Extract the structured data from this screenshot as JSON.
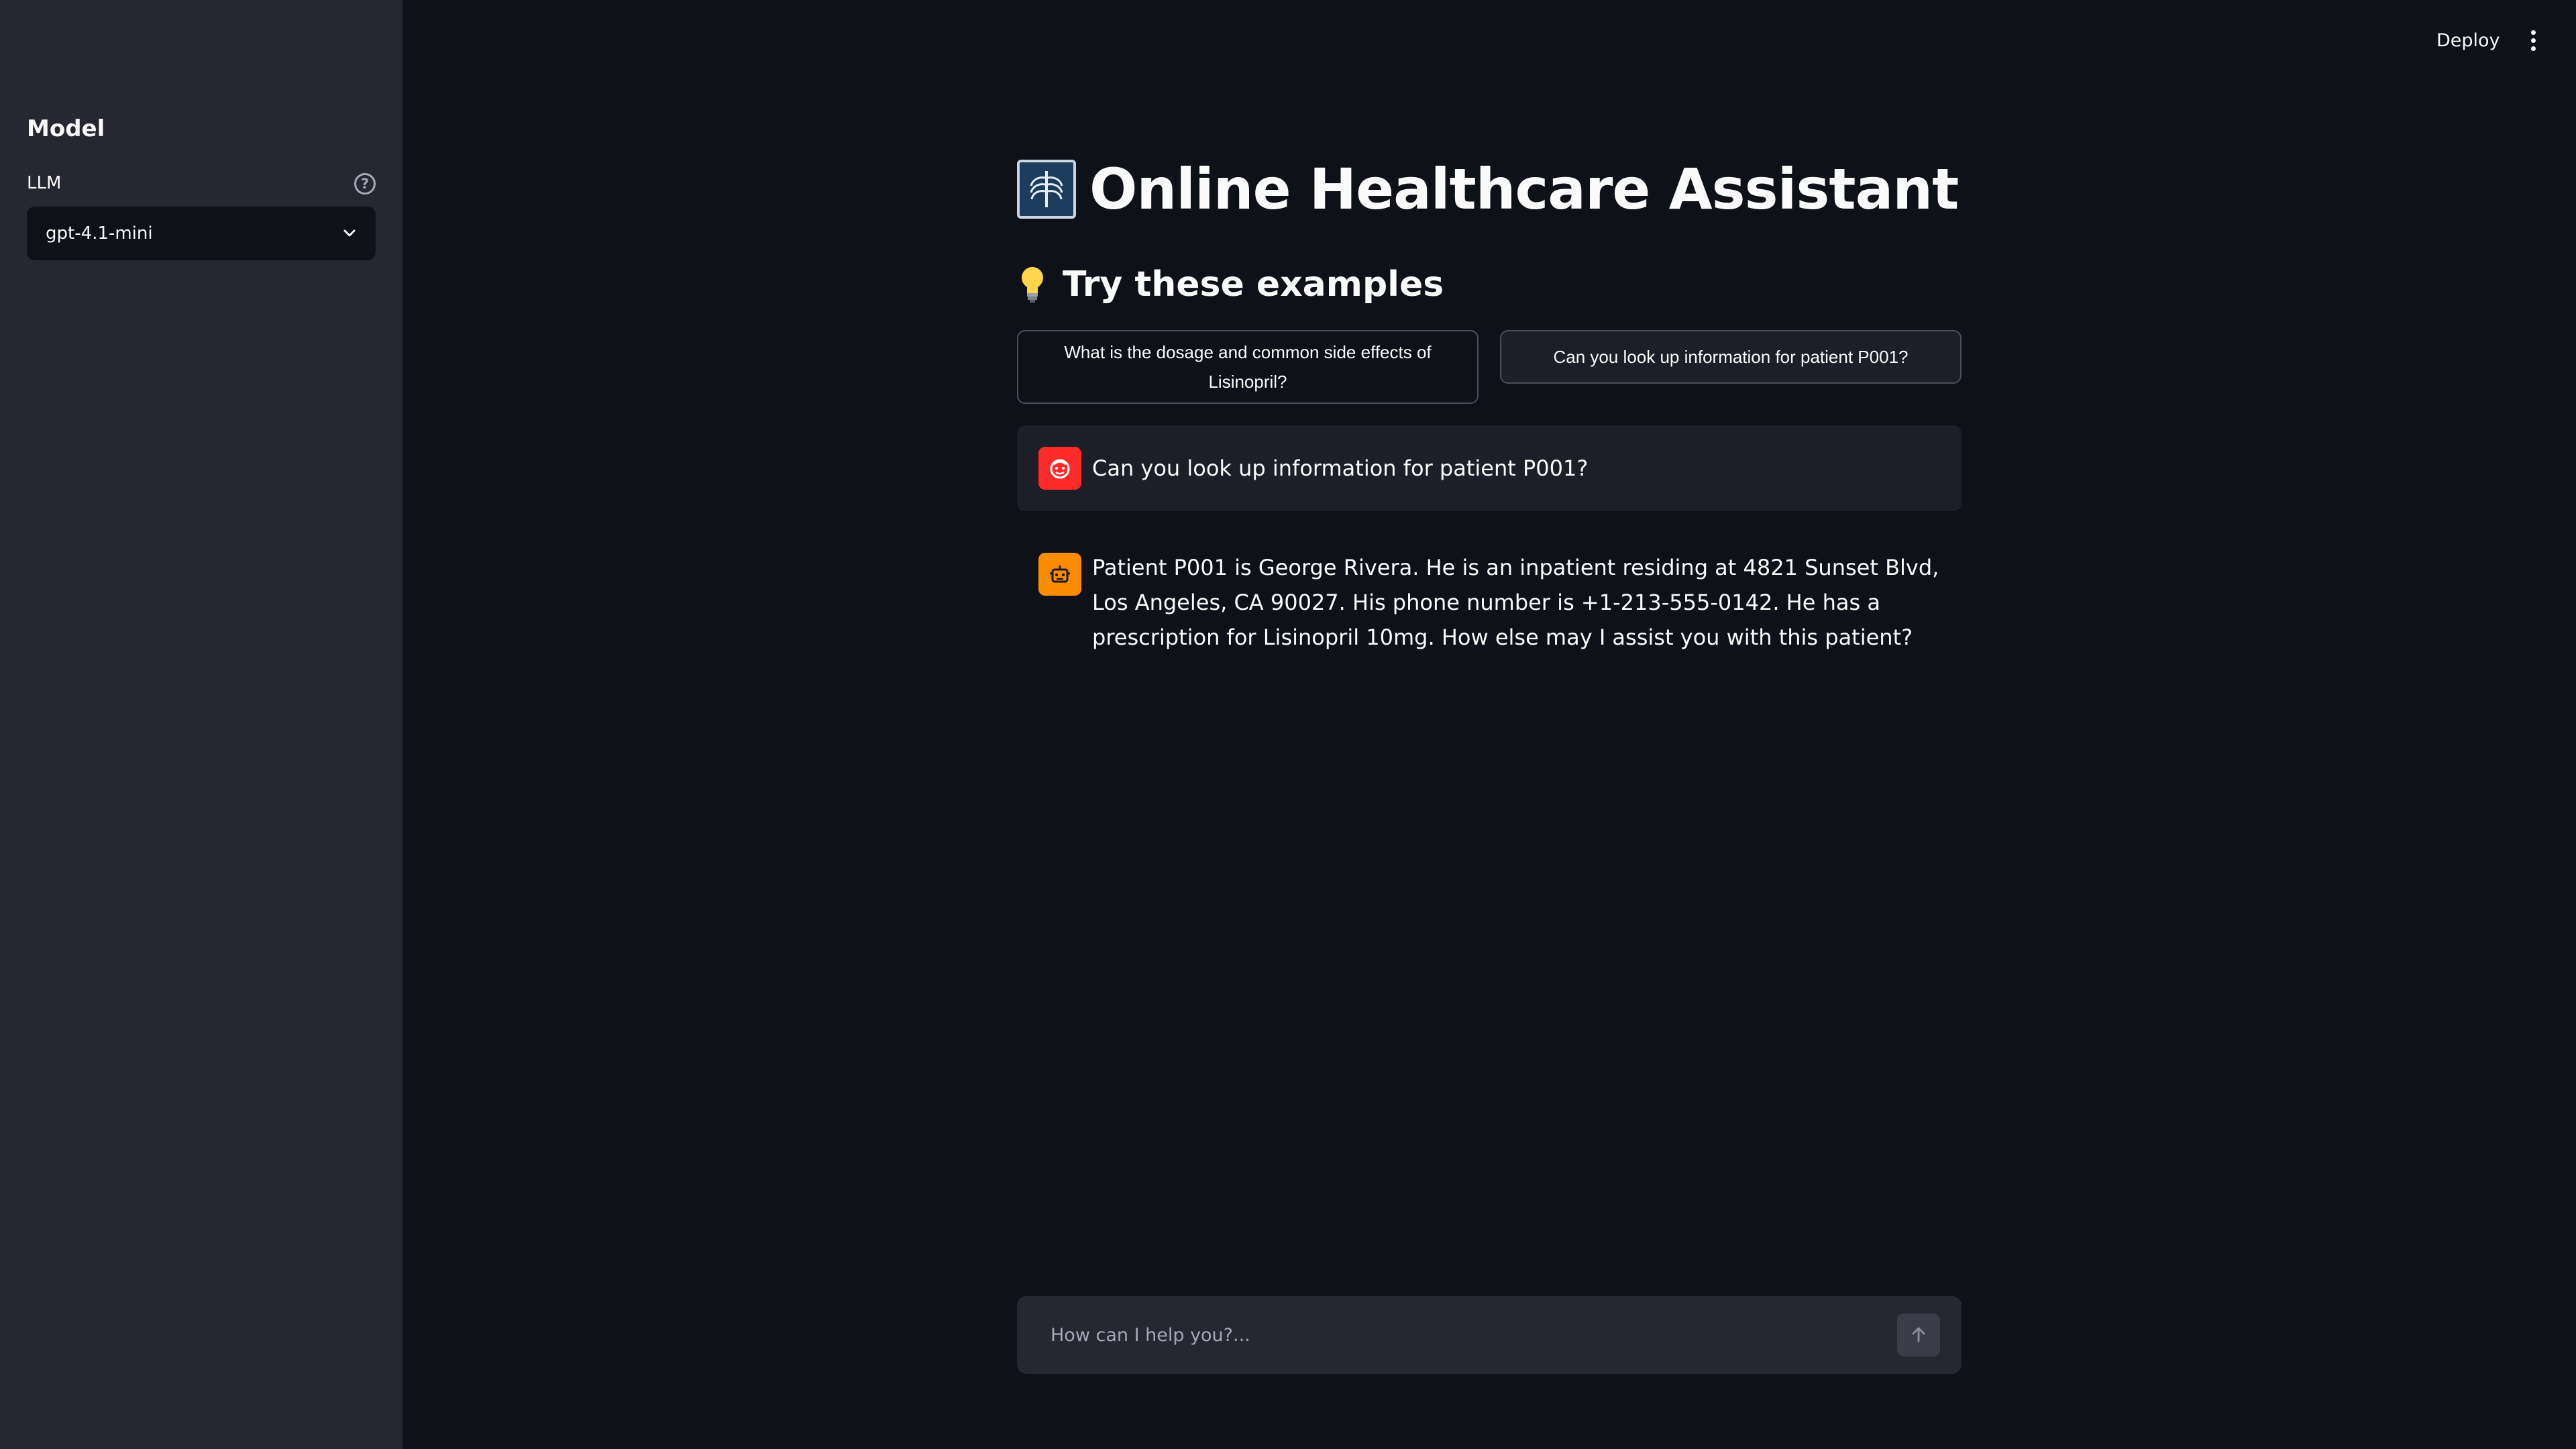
{
  "sidebar": {
    "heading": "Model",
    "llm_label": "LLM",
    "help_glyph": "?",
    "selected_model": "gpt-4.1-mini"
  },
  "header": {
    "deploy_label": "Deploy"
  },
  "main": {
    "title": "Online Healthcare Assistant",
    "examples_title": "Try these examples",
    "examples": [
      "What is the dosage and common side effects of Lisinopril?",
      "Can you look up information for patient P001?"
    ],
    "messages": [
      {
        "role": "user",
        "avatar_icon": "face-icon",
        "text": "Can you look up information for patient P001?"
      },
      {
        "role": "assistant",
        "avatar_icon": "robot-icon",
        "text": "Patient P001 is George Rivera. He is an inpatient residing at 4821 Sunset Blvd, Los Angeles, CA 90027. His phone number is +1-213-555-0142. He has a prescription for Lisinopril 10mg. How else may I assist you with this patient?"
      }
    ],
    "chat_placeholder": "How can I help you?..."
  },
  "colors": {
    "background": "#0e1117",
    "sidebar": "#262730",
    "user_avatar": "#ff2b2b",
    "assistant_avatar": "#ff8c00"
  }
}
